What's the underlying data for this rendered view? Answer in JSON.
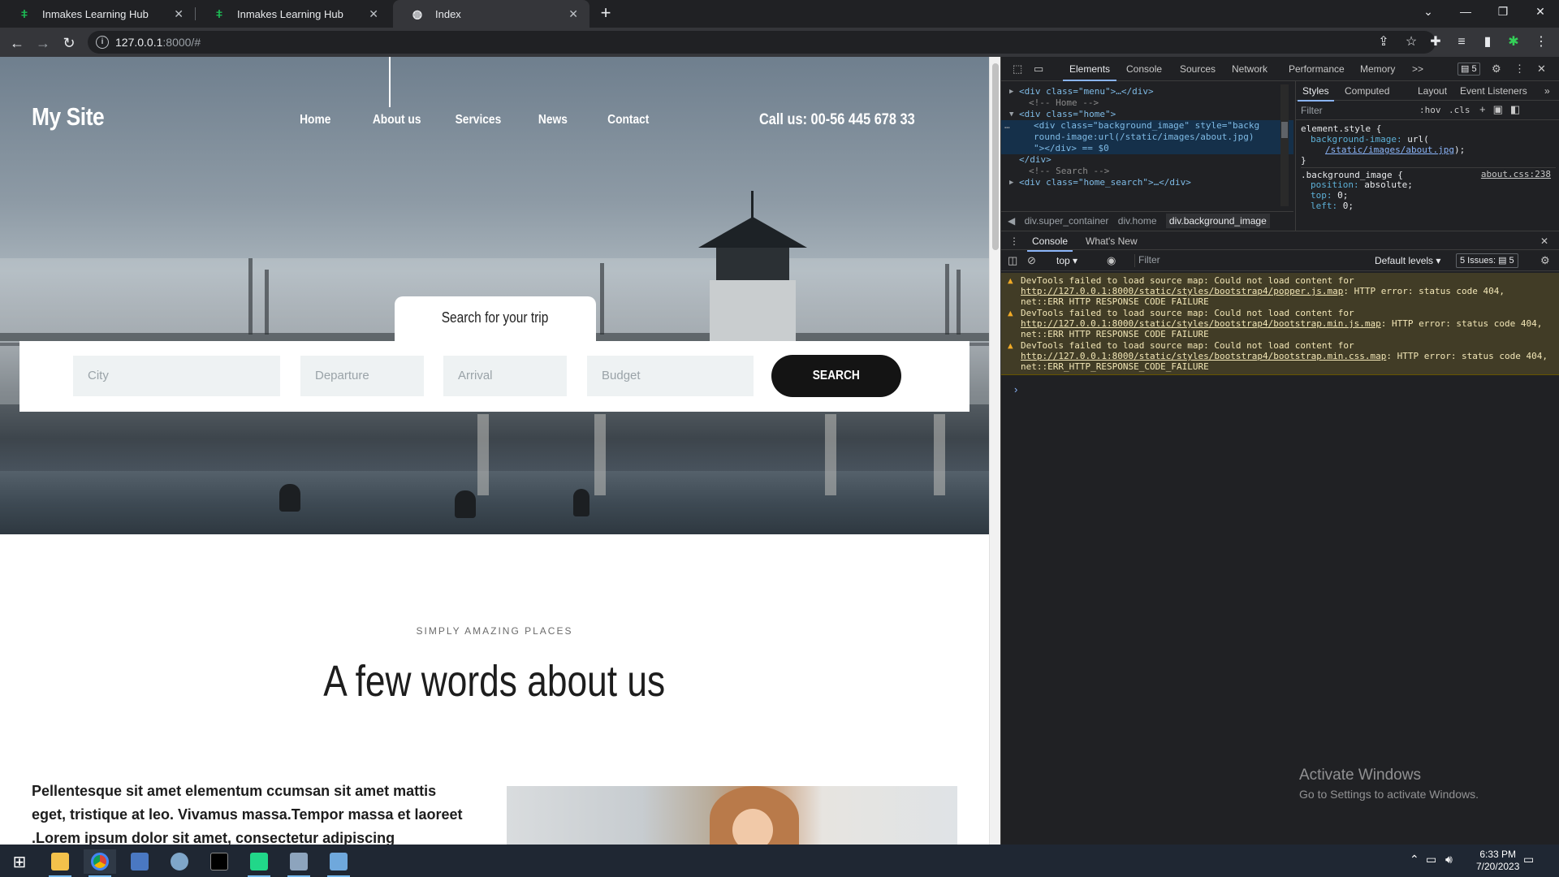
{
  "browser": {
    "tabs": [
      {
        "title": "Inmakes Learning Hub",
        "active": false
      },
      {
        "title": "Inmakes Learning Hub",
        "active": false
      },
      {
        "title": "Index",
        "active": true
      }
    ],
    "url_host": "127.0.0.1",
    "url_rest": ":8000/#"
  },
  "site": {
    "logo": "My Site",
    "nav": [
      "Home",
      "About us",
      "Services",
      "News",
      "Contact"
    ],
    "call": "Call us: 00-56 445 678 33",
    "search_tab": "Search for your trip",
    "fields": {
      "city": "City",
      "departure": "Departure",
      "arrival": "Arrival",
      "budget": "Budget"
    },
    "search_button": "SEARCH",
    "eyebrow": "SIMPLY AMAZING PLACES",
    "heading": "A few words about us",
    "paragraph": "Pellentesque sit amet elementum ccumsan sit amet mattis eget, tristique at leo. Vivamus massa.Tempor massa et laoreet .Lorem ipsum dolor sit amet, consectetur adipiscing"
  },
  "devtools": {
    "tabs": [
      "Elements",
      "Console",
      "Sources",
      "Network",
      "Performance",
      "Memory"
    ],
    "more": ">>",
    "badge": "5",
    "elements": [
      {
        "indent": 0,
        "arrow": "▶",
        "html": "<div class=\"menu\">…</div>"
      },
      {
        "indent": 1,
        "comment": "<!-- Home -->"
      },
      {
        "indent": 0,
        "arrow": "▼",
        "html": "<div class=\"home\">"
      },
      {
        "indent": 1,
        "selected": true,
        "html": "<div class=\"background_image\" style=\"backg"
      },
      {
        "indent": 1,
        "selected": true,
        "html": "round-image:url(/static/images/about.jpg)"
      },
      {
        "indent": 1,
        "selected": true,
        "html": "\"></div> == $0"
      },
      {
        "indent": 0,
        "html": "</div>"
      },
      {
        "indent": 1,
        "comment": "<!-- Search -->"
      },
      {
        "indent": 0,
        "arrow": "▶",
        "html": "<div class=\"home_search\">…</div>"
      }
    ],
    "breadcrumbs": [
      "div.super_container",
      "div.home",
      "div.background_image"
    ],
    "styles_tabs": [
      "Styles",
      "Computed",
      "Layout",
      "Event Listeners"
    ],
    "styles_filter": "Filter",
    "hov": ":hov",
    "cls": ".cls",
    "rules": {
      "element_style": "element.style {",
      "bg_prop": "background-image:",
      "bg_url_fn": "url(",
      "bg_url": "/static/images/about.jpg",
      "bg_url_close": ");",
      "close": "}",
      "selector": ".background_image {",
      "source": "about.css:238",
      "position": "position:",
      "position_val": "absolute;",
      "top": "top:",
      "top_val": "0;",
      "left": "left:",
      "left_val": "0;"
    },
    "console_tabs": [
      "Console",
      "What's New"
    ],
    "context": "top",
    "console_filter": "Filter",
    "levels": "Default levels",
    "issues": "5 Issues:",
    "issues_count": "5",
    "messages": [
      {
        "pre": "DevTools failed to load source map: Could not load content for ",
        "link": "http://127.0.0.1:8000/static/styles/bootstrap4/popper.js.map",
        "post": ": HTTP error: status code 404, net::ERR_HTTP_RESPONSE_CODE_FAILURE"
      },
      {
        "pre": "DevTools failed to load source map: Could not load content for ",
        "link": "http://127.0.0.1:8000/static/styles/bootstrap4/bootstrap.min.js.map",
        "post": ": HTTP error: status code 404, net::ERR_HTTP_RESPONSE_CODE_FAILURE"
      },
      {
        "pre": "DevTools failed to load source map: Could not load content for ",
        "link": "http://127.0.0.1:8000/static/styles/bootstrap4/bootstrap.min.css.map",
        "post": ": HTTP error: status code 404, net::ERR_HTTP_RESPONSE_CODE_FAILURE"
      }
    ]
  },
  "watermark": {
    "line1": "Activate Windows",
    "line2": "Go to Settings to activate Windows."
  },
  "taskbar": {
    "time": "6:33 PM",
    "date": "7/20/2023"
  }
}
